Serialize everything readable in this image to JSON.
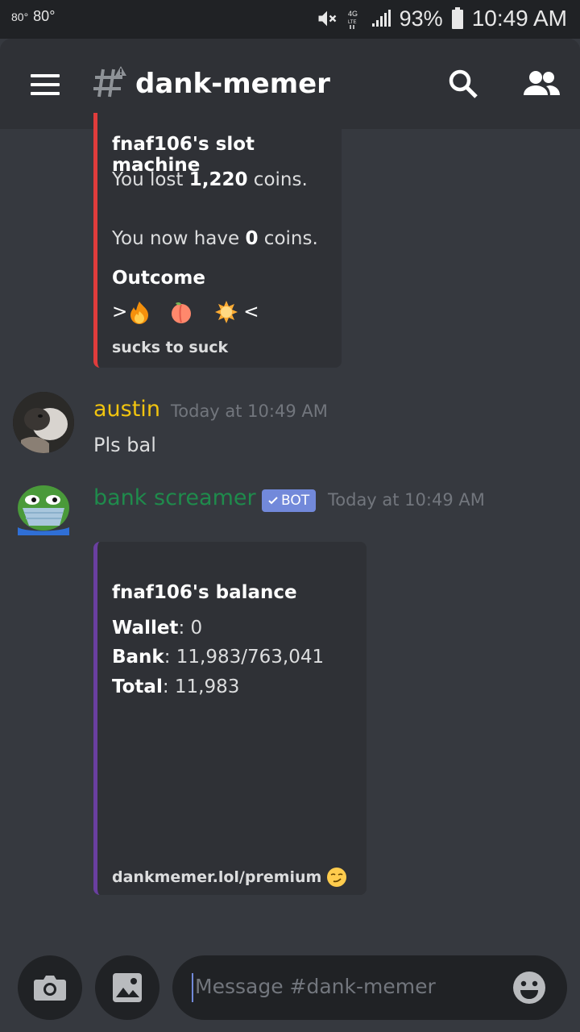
{
  "status_bar": {
    "temp_small": "80°",
    "temp": "80°",
    "battery_pct": "93%",
    "time": "10:49 AM"
  },
  "header": {
    "channel_name": "dank-memer"
  },
  "embed_slot": {
    "title": "fnaf106's slot machine",
    "lost_prefix": "You lost ",
    "lost_amount": "1,220",
    "lost_suffix": " coins.",
    "now_prefix": "You now have ",
    "now_amount": "0",
    "now_suffix": " coins.",
    "field_name": "Outcome",
    "slot_open": ">",
    "slot_close": "<",
    "footer": "sucks to suck"
  },
  "messages": [
    {
      "username": "austin",
      "timestamp": "Today at 10:49 AM",
      "text": "Pls bal",
      "color": "#f1c40f"
    },
    {
      "username": "bank screamer",
      "badge": "BOT",
      "timestamp": "Today at 10:49 AM",
      "color": "#1f8b4c"
    }
  ],
  "embed_balance": {
    "title": "fnaf106's balance",
    "wallet_label": "Wallet",
    "wallet_value": ": 0",
    "bank_label": "Bank",
    "bank_value": ": 11,983/763,041",
    "total_label": "Total",
    "total_value": ": 11,983",
    "footer": "dankmemer.lol/premium"
  },
  "composer": {
    "placeholder": "Message #dank-memer"
  }
}
